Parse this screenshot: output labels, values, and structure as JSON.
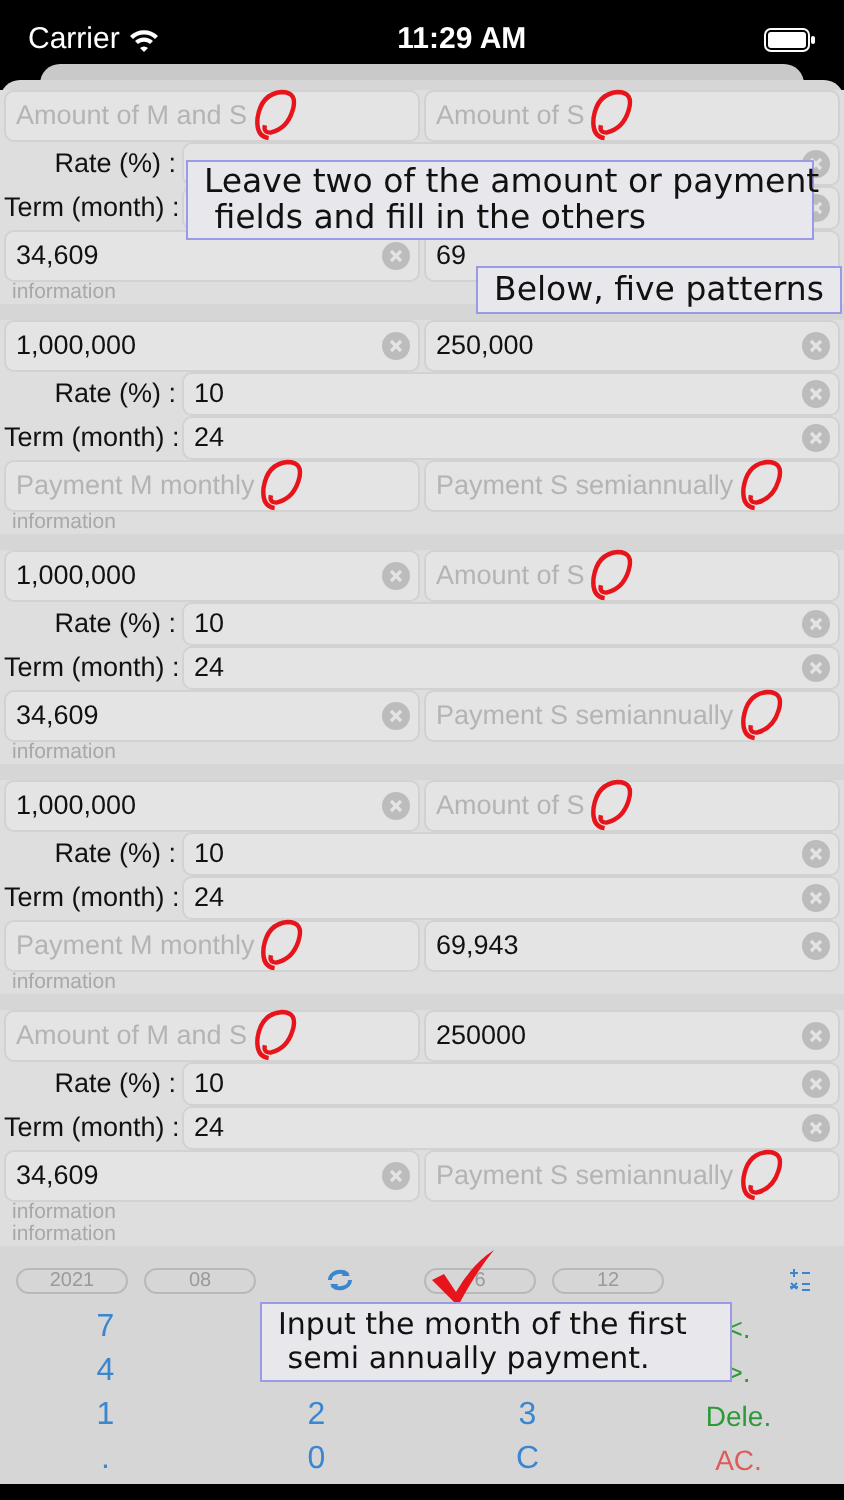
{
  "status_bar": {
    "carrier": "Carrier",
    "time": "11:29 AM"
  },
  "patterns": [
    {
      "top": [
        {
          "placeholder": "Amount of M and S",
          "marked": true,
          "clear": false
        },
        {
          "placeholder": "Amount of S",
          "marked": true,
          "clear": false
        }
      ],
      "rate": {
        "label": "Rate (%) :",
        "clear": true
      },
      "term": {
        "label": "Term (month) :",
        "clear": true
      },
      "bottom": [
        {
          "value": "34,609",
          "marked": false,
          "clear": true
        },
        {
          "value": "69",
          "marked": false,
          "clear": false
        }
      ],
      "info": [
        "information"
      ]
    },
    {
      "top": [
        {
          "value": "1,000,000",
          "marked": false,
          "clear": true
        },
        {
          "value": "250,000",
          "marked": false,
          "clear": true
        }
      ],
      "rate": {
        "label": "Rate (%) :",
        "value": "10",
        "clear": true
      },
      "term": {
        "label": "Term (month) :",
        "value": "24",
        "clear": true
      },
      "bottom": [
        {
          "placeholder": "Payment M monthly",
          "marked": true,
          "clear": false
        },
        {
          "placeholder": "Payment S semiannually",
          "marked": true,
          "clear": false
        }
      ],
      "info": [
        "information"
      ]
    },
    {
      "top": [
        {
          "value": "1,000,000",
          "marked": false,
          "clear": true
        },
        {
          "placeholder": "Amount of S",
          "marked": true,
          "clear": false
        }
      ],
      "rate": {
        "label": "Rate (%) :",
        "value": "10",
        "clear": true
      },
      "term": {
        "label": "Term (month) :",
        "value": "24",
        "clear": true
      },
      "bottom": [
        {
          "value": "34,609",
          "marked": false,
          "clear": true
        },
        {
          "placeholder": "Payment S semiannually",
          "marked": true,
          "clear": false
        }
      ],
      "info": [
        "information"
      ]
    },
    {
      "top": [
        {
          "value": "1,000,000",
          "marked": false,
          "clear": true
        },
        {
          "placeholder": "Amount of S",
          "marked": true,
          "clear": false
        }
      ],
      "rate": {
        "label": "Rate (%) :",
        "value": "10",
        "clear": true
      },
      "term": {
        "label": "Term (month) :",
        "value": "24",
        "clear": true
      },
      "bottom": [
        {
          "placeholder": "Payment M monthly",
          "marked": true,
          "clear": false
        },
        {
          "value": "69,943",
          "marked": false,
          "clear": true
        }
      ],
      "info": [
        "information"
      ]
    },
    {
      "top": [
        {
          "placeholder": "Amount of M and S",
          "marked": true,
          "clear": false
        },
        {
          "value": "250000",
          "marked": false,
          "clear": true
        }
      ],
      "rate": {
        "label": "Rate (%) :",
        "value": "10",
        "clear": true
      },
      "term": {
        "label": "Term (month) :",
        "value": "24",
        "clear": true
      },
      "bottom": [
        {
          "value": "34,609",
          "marked": false,
          "clear": true
        },
        {
          "placeholder": "Payment S semiannually",
          "marked": true,
          "clear": false
        }
      ],
      "info": [
        "information",
        "information"
      ]
    }
  ],
  "date_row": [
    {
      "kind": "pill",
      "label": "2021"
    },
    {
      "kind": "pill",
      "label": "08"
    },
    {
      "kind": "sync"
    },
    {
      "kind": "pill",
      "label": "6"
    },
    {
      "kind": "pill",
      "label": "12"
    },
    {
      "kind": "calc"
    }
  ],
  "keypad": [
    [
      {
        "kind": "digit",
        "label": "7"
      },
      {
        "kind": "covered"
      },
      {
        "kind": "covered"
      },
      {
        "kind": "edit",
        "label": "<."
      }
    ],
    [
      {
        "kind": "digit",
        "label": "4"
      },
      {
        "kind": "covered"
      },
      {
        "kind": "covered"
      },
      {
        "kind": "edit",
        "label": ">."
      }
    ],
    [
      {
        "kind": "digit",
        "label": "1"
      },
      {
        "kind": "digit",
        "label": "2"
      },
      {
        "kind": "digit",
        "label": "3"
      },
      {
        "kind": "edit",
        "label": "Dele."
      }
    ],
    [
      {
        "kind": "digit",
        "label": "."
      },
      {
        "kind": "digit",
        "label": "0"
      },
      {
        "kind": "digit",
        "label": "C"
      },
      {
        "kind": "clear",
        "label": "AC."
      }
    ]
  ],
  "callouts": [
    {
      "kind": "top",
      "text": "Leave two of the amount or payment\n fields and fill in the others"
    },
    {
      "kind": "middle",
      "text": "Below, five patterns"
    },
    {
      "kind": "bottom",
      "text": "Input the month of the first\n semi annually payment."
    }
  ]
}
